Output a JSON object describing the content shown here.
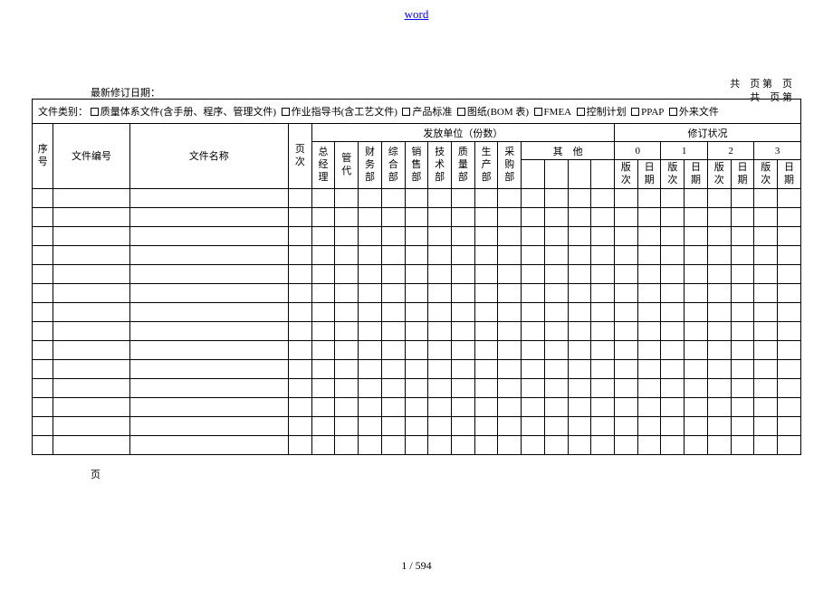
{
  "header_link": "word",
  "top_right_1": "共　页 第　页",
  "top_right_2": "共　页 第",
  "revision_date_label": "最新修订日期：",
  "footer_ye": "页",
  "page_number": "1 / 594",
  "category": {
    "label": "文件类别：",
    "opts": [
      "质量体系文件(含手册、程序、管理文件)",
      "作业指导书(含工艺文件)",
      "产品标准",
      "图纸(BOM 表)",
      "FMEA",
      "控制计划",
      "PPAP",
      "外来文件"
    ]
  },
  "cols": {
    "seq": "序号",
    "doc_no": "文件编号",
    "doc_name": "文件名称",
    "pages": "页次",
    "distribution": "发放单位（份数）",
    "revision": "修订状况",
    "depts": [
      "总经理",
      "管代",
      "财务部",
      "综合部",
      "销售部",
      "技术部",
      "质量部",
      "生产部",
      "采购部"
    ],
    "other": "其　他",
    "rev_nums": [
      "0",
      "1",
      "2",
      "3"
    ],
    "ver": "版次",
    "date": "日期"
  }
}
